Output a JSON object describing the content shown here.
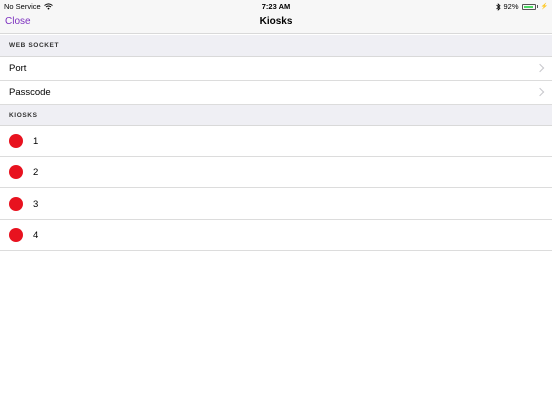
{
  "status_bar": {
    "carrier": "No Service",
    "time": "7:23 AM",
    "battery_percent_label": "92%",
    "battery_level": 0.92,
    "icons": [
      "wifi-icon",
      "bluetooth-icon",
      "battery-icon",
      "charging-icon"
    ]
  },
  "nav": {
    "close_label": "Close",
    "title": "Kiosks"
  },
  "websocket_section": {
    "header": "WEB SOCKET",
    "rows": [
      {
        "label": "Port"
      },
      {
        "label": "Passcode"
      }
    ]
  },
  "kiosks_section": {
    "header": "KIOSKS",
    "items": [
      {
        "label": "1",
        "status_color": "#e8121f"
      },
      {
        "label": "2",
        "status_color": "#e8121f"
      },
      {
        "label": "3",
        "status_color": "#e8121f"
      },
      {
        "label": "4",
        "status_color": "#e8121f"
      }
    ]
  },
  "colors": {
    "accent": "#7b2fbf",
    "status_red": "#e8121f",
    "battery_green": "#4cd964"
  }
}
